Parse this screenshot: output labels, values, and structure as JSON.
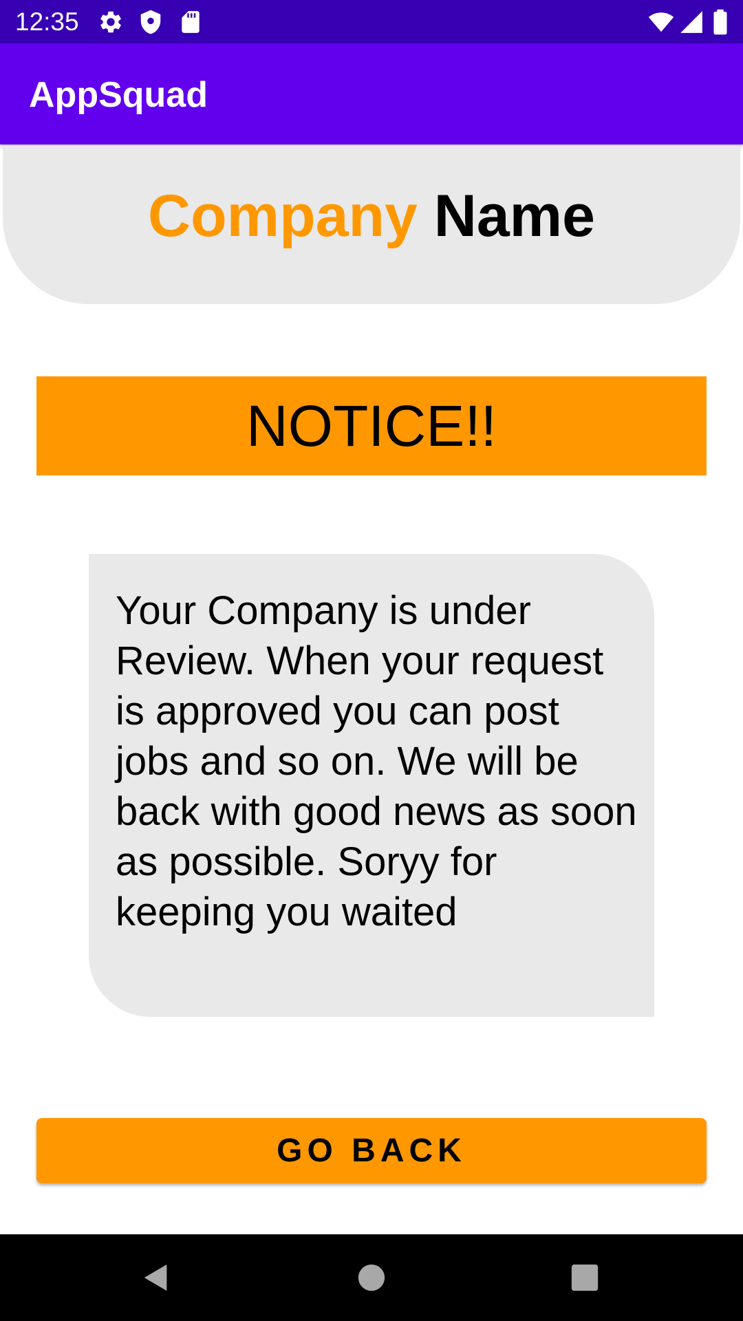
{
  "status_bar": {
    "time": "12:35",
    "icons": [
      "gear-icon",
      "shield-icon",
      "sd-card-icon",
      "wifi-icon",
      "signal-icon",
      "battery-icon"
    ]
  },
  "app_bar": {
    "title": "AppSquad"
  },
  "header": {
    "word1": "Company",
    "word2": "Name"
  },
  "notice": {
    "text": "NOTICE!!"
  },
  "message": {
    "text": "Your Company is under Review. When your request is approved you can post jobs and so on. We will be back with good news as soon as possible. Soryy for keeping you waited"
  },
  "actions": {
    "go_back_label": "GO BACK"
  },
  "nav_bar": {
    "icons": [
      "back-icon",
      "home-icon",
      "recents-icon"
    ]
  },
  "colors": {
    "status_bar": "#3700B3",
    "app_bar": "#6200EE",
    "accent_orange": "#FF9800",
    "card_gray": "#E9E9E9"
  }
}
